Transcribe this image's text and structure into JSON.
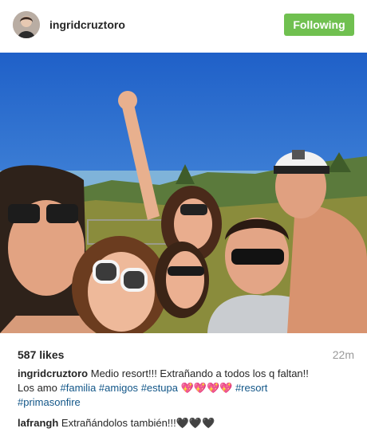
{
  "post": {
    "username": "ingridcruztoro",
    "follow_label": "Following",
    "likes": "587 likes",
    "time": "22m",
    "caption": {
      "username": "ingridcruztoro",
      "line1": "Medio resort!!! Extrañando a todos los q faltan!!",
      "line2_prefix": "Los amo",
      "tags": [
        "#familia",
        "#amigos",
        "#estupa",
        "#resort",
        "#primasonfire"
      ],
      "hearts": "💖💖💖💖"
    },
    "comments": [
      {
        "username": "lafrangh",
        "text": "Extrañándolos también!!!🖤🖤🖤"
      }
    ]
  },
  "colors": {
    "follow_green": "#70c050",
    "hashtag_blue": "#125688",
    "muted_gray": "#999999"
  },
  "icons": {
    "avatar": "profile-photo"
  }
}
